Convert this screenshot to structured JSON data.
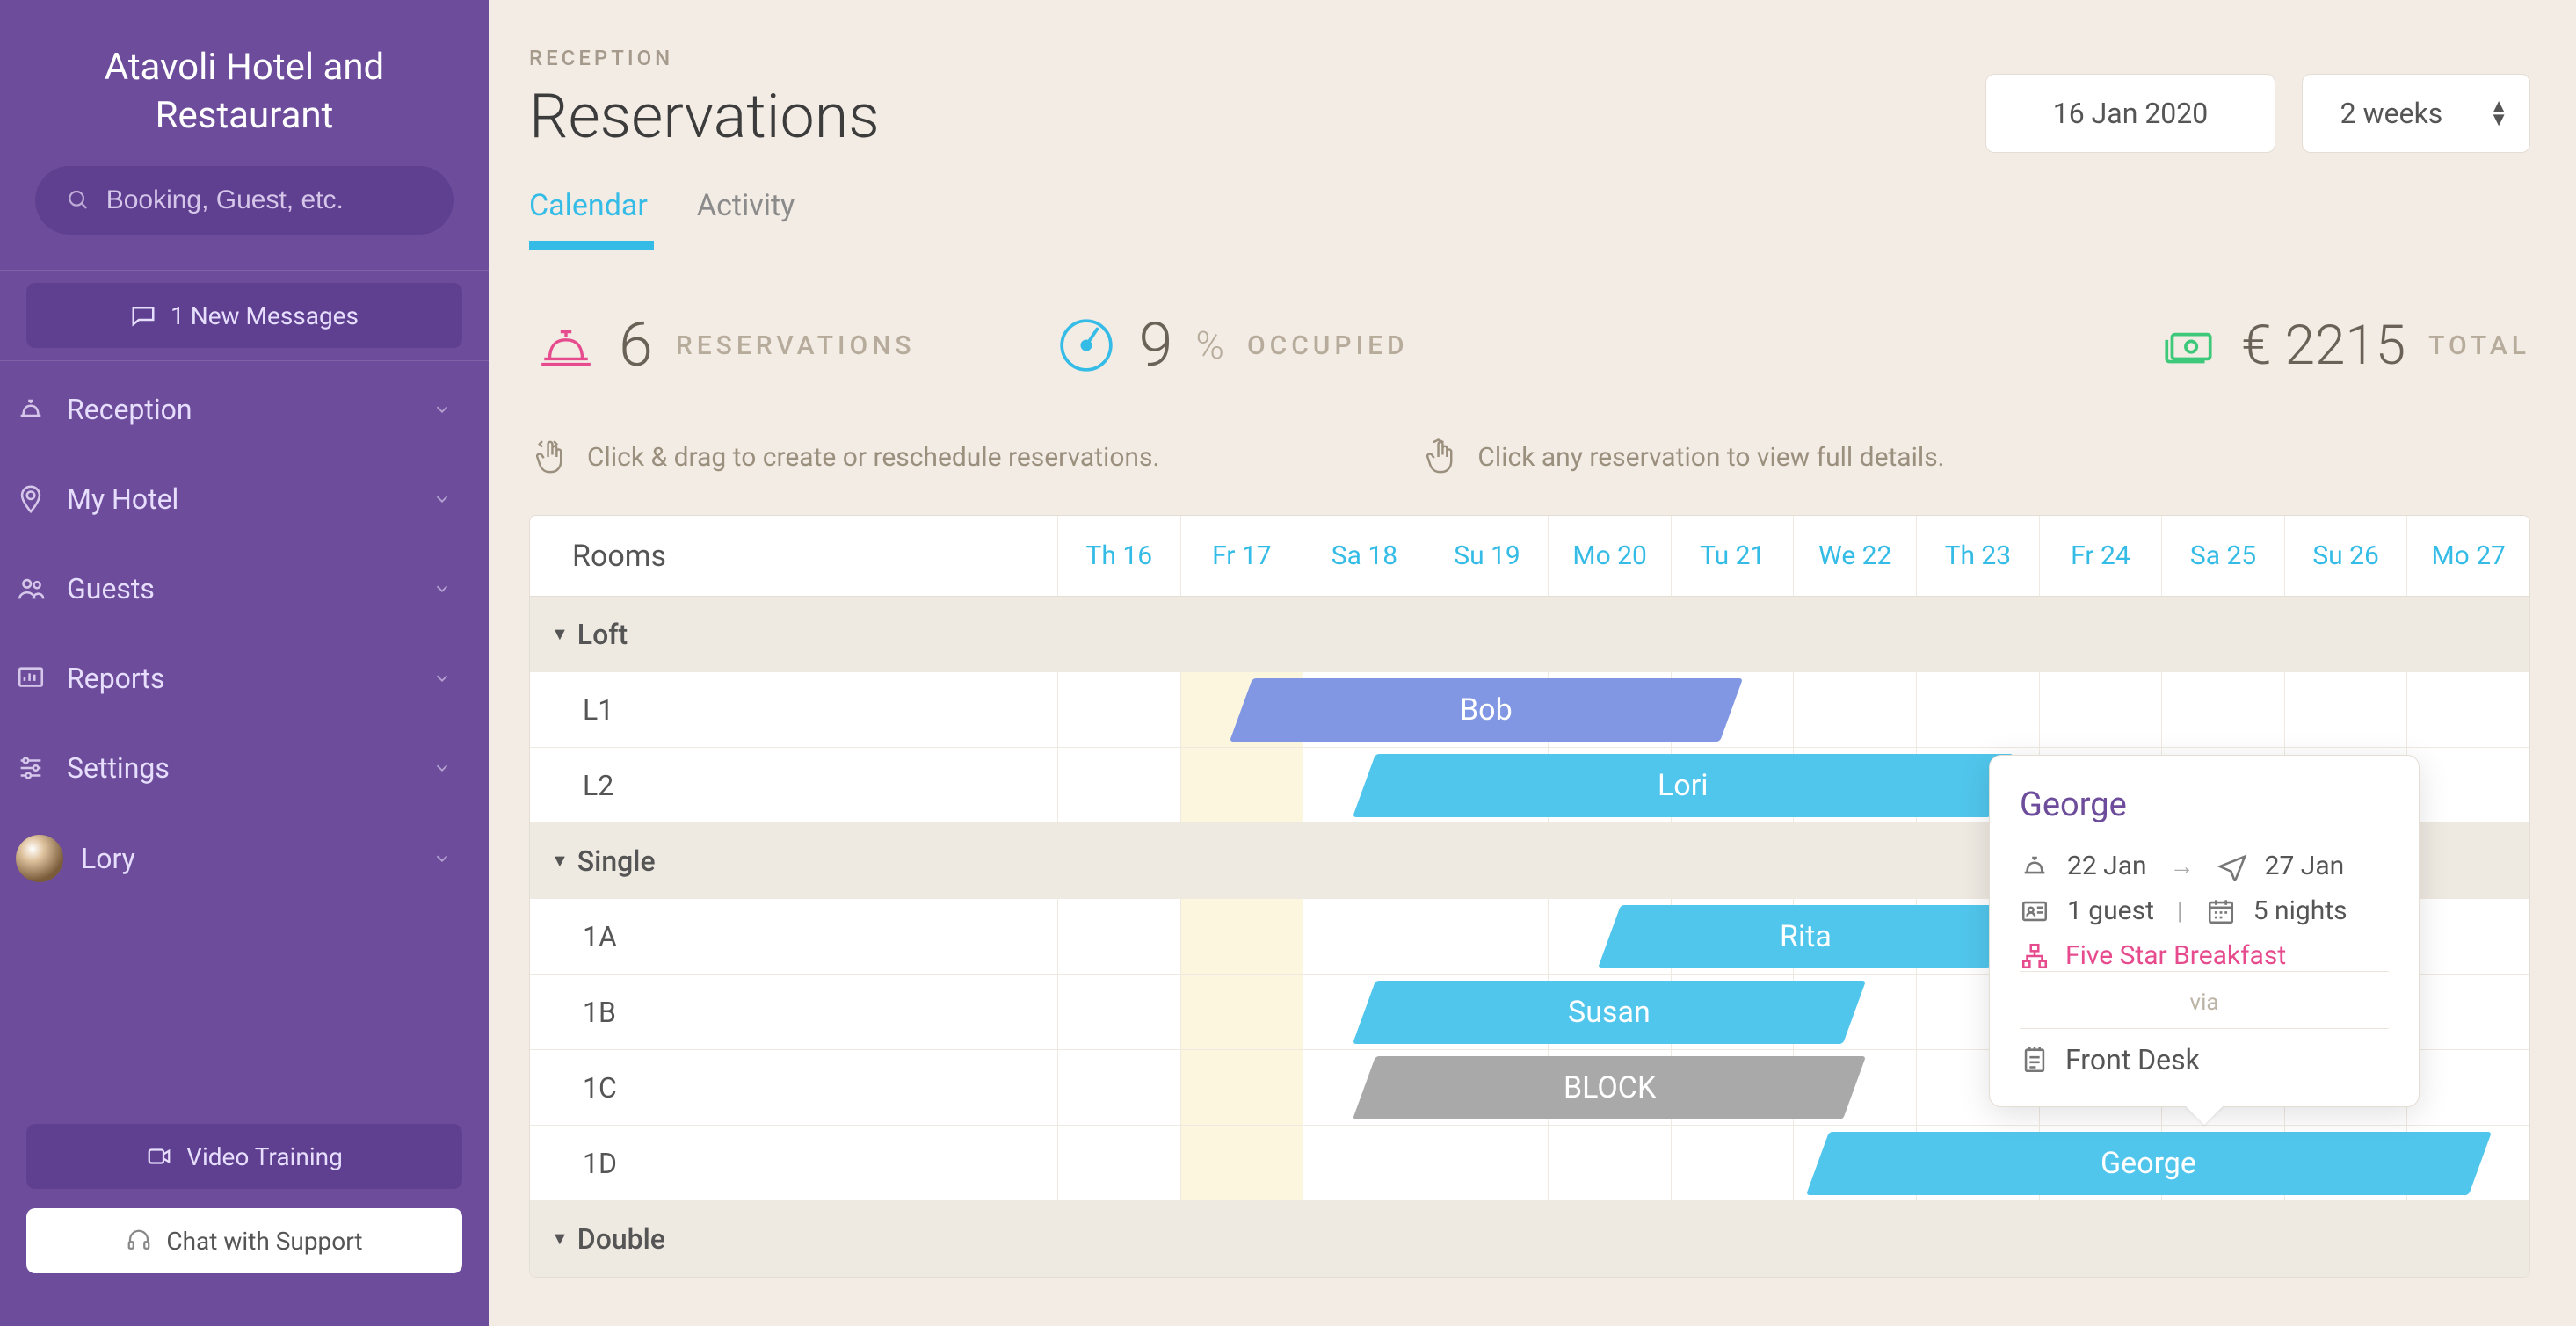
{
  "brand": "Atavoli Hotel and Restaurant",
  "search": {
    "placeholder": "Booking, Guest, etc."
  },
  "messages": {
    "label": "1 New Messages"
  },
  "nav": [
    {
      "label": "Reception"
    },
    {
      "label": "My Hotel"
    },
    {
      "label": "Guests"
    },
    {
      "label": "Reports"
    },
    {
      "label": "Settings"
    }
  ],
  "user": {
    "name": "Lory"
  },
  "footer": {
    "training": "Video Training",
    "support": "Chat with Support"
  },
  "header": {
    "breadcrumb": "RECEPTION",
    "title": "Reservations",
    "date": "16 Jan 2020",
    "range": "2 weeks"
  },
  "tabs": [
    {
      "label": "Calendar",
      "active": true
    },
    {
      "label": "Activity",
      "active": false
    }
  ],
  "stats": {
    "reservations": {
      "value": "6",
      "label": "RESERVATIONS"
    },
    "occupied": {
      "value": "9",
      "pct": "%",
      "label": "OCCUPIED"
    },
    "total": {
      "currency": "€",
      "value": "2215",
      "label": "TOTAL"
    }
  },
  "hints": {
    "drag": "Click & drag to create or reschedule reservations.",
    "click": "Click any reservation to view full details."
  },
  "calendar": {
    "rooms_label": "Rooms",
    "days": [
      "Th 16",
      "Fr 17",
      "Sa 18",
      "Su 19",
      "Mo 20",
      "Tu 21",
      "We 22",
      "Th 23",
      "Fr 24",
      "Sa 25",
      "Su 26",
      "Mo 27"
    ],
    "groups": [
      {
        "name": "Loft",
        "rooms": [
          "L1",
          "L2"
        ]
      },
      {
        "name": "Single",
        "rooms": [
          "1A",
          "1B",
          "1C",
          "1D"
        ]
      },
      {
        "name": "Double",
        "rooms": []
      }
    ],
    "bars": [
      {
        "guest": "Bob",
        "room": "L1",
        "start_col": 1.5,
        "span_cols": 4,
        "color": "blue"
      },
      {
        "guest": "Lori",
        "room": "L2",
        "start_col": 2.5,
        "span_cols": 5.2,
        "color": "sky"
      },
      {
        "guest": "Rita",
        "room": "1A",
        "start_col": 4.5,
        "span_cols": 3.2,
        "color": "sky"
      },
      {
        "guest": "Susan",
        "room": "1B",
        "start_col": 2.5,
        "span_cols": 4,
        "color": "sky"
      },
      {
        "guest": "BLOCK",
        "room": "1C",
        "start_col": 2.5,
        "span_cols": 4,
        "color": "gray"
      },
      {
        "guest": "George",
        "room": "1D",
        "start_col": 6.2,
        "span_cols": 5.4,
        "color": "sky"
      }
    ]
  },
  "popover": {
    "guest": "George",
    "from": "22 Jan",
    "to": "27 Jan",
    "arrow": "→",
    "guests": "1 guest",
    "sep": "|",
    "nights": "5 nights",
    "rate": "Five Star Breakfast",
    "via_label": "via",
    "source": "Front Desk"
  },
  "colors": {
    "primary": "#6d4d9b",
    "accent": "#35bce6",
    "pink": "#e64b8d",
    "green": "#3ec97a"
  }
}
